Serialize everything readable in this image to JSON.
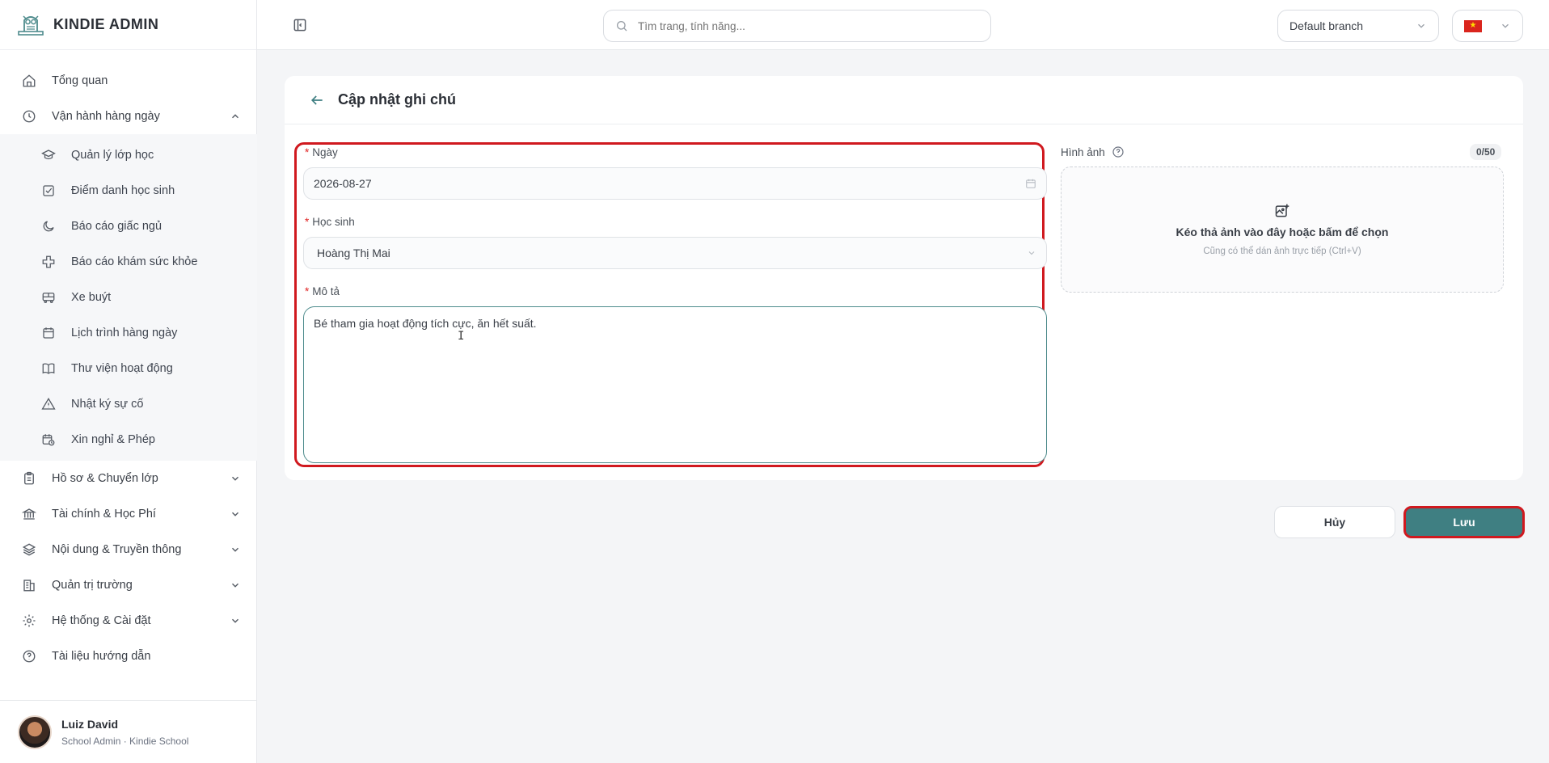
{
  "app": {
    "name": "KINDIE ADMIN"
  },
  "sidebar": {
    "items": [
      {
        "label": "Tổng quan",
        "icon": "home-icon"
      },
      {
        "label": "Vận hành hàng ngày",
        "icon": "clock-icon",
        "expanded": true,
        "children": [
          {
            "label": "Quản lý lớp học",
            "icon": "graduation-cap-icon"
          },
          {
            "label": "Điểm danh học sinh",
            "icon": "check-square-icon"
          },
          {
            "label": "Báo cáo giấc ngủ",
            "icon": "moon-icon"
          },
          {
            "label": "Báo cáo khám sức khỏe",
            "icon": "plus-cross-icon"
          },
          {
            "label": "Xe buýt",
            "icon": "bus-icon"
          },
          {
            "label": "Lịch trình hàng ngày",
            "icon": "calendar-icon"
          },
          {
            "label": "Thư viện hoạt động",
            "icon": "book-icon"
          },
          {
            "label": "Nhật ký sự cố",
            "icon": "warning-icon"
          },
          {
            "label": "Xin nghỉ & Phép",
            "icon": "calendar-clock-icon"
          }
        ]
      },
      {
        "label": "Hồ sơ & Chuyển lớp",
        "icon": "clipboard-icon"
      },
      {
        "label": "Tài chính & Học Phí",
        "icon": "bank-icon"
      },
      {
        "label": "Nội dung & Truyền thông",
        "icon": "layers-icon"
      },
      {
        "label": "Quản trị trường",
        "icon": "building-icon"
      },
      {
        "label": "Hệ thống & Cài đặt",
        "icon": "gear-icon"
      },
      {
        "label": "Tài liệu hướng dẫn",
        "icon": "help-circle-icon"
      }
    ]
  },
  "user": {
    "name": "Luiz David",
    "role": "School Admin · Kindie School"
  },
  "topbar": {
    "search_placeholder": "Tìm trang, tính năng...",
    "branch": "Default branch",
    "language_flag": "vietnam-flag-icon"
  },
  "page": {
    "title": "Cập nhật ghi chú",
    "fields": {
      "date_label": "Ngày",
      "date_value": "2026-08-27",
      "student_label": "Học sinh",
      "student_value": "Hoàng Thị Mai",
      "description_label": "Mô tả",
      "description_value": "Bé tham gia hoạt động tích cực, ăn hết suất.",
      "required_marker": "*"
    },
    "images": {
      "label": "Hình ảnh",
      "count": "0/50",
      "drop_title": "Kéo thả ảnh vào đây hoặc bấm để chọn",
      "drop_sub": "Cũng có thể dán ảnh trực tiếp (Ctrl+V)"
    },
    "actions": {
      "cancel": "Hủy",
      "save": "Lưu"
    }
  },
  "colors": {
    "accent": "#3f7f82",
    "highlight": "#d0191f",
    "required": "#e02424"
  }
}
